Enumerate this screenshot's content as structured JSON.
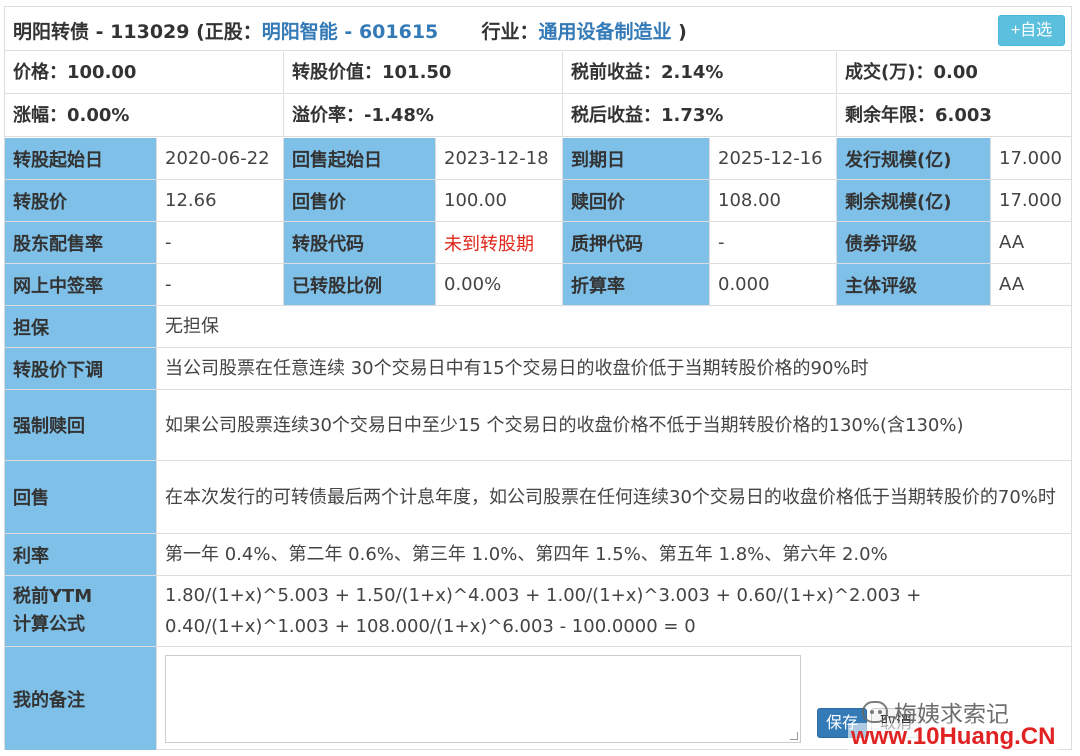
{
  "header": {
    "bond_name": "明阳转债",
    "bond_code": "113029",
    "stock_prefix": "(正股：",
    "stock_name": "明阳智能",
    "stock_code": "601615",
    "industry_label": "行业：",
    "industry": "通用设备制造业",
    "suffix": ")",
    "add_watch": "+自选"
  },
  "summary": [
    [
      "价格：100.00",
      "转股价值：101.50",
      "税前收益：2.14%",
      "成交(万)：0.00"
    ],
    [
      "涨幅：0.00%",
      "溢价率：-1.48%",
      "税后收益：1.73%",
      "剩余年限：6.003"
    ]
  ],
  "grid": [
    [
      {
        "label": "转股起始日",
        "value": "2020-06-22"
      },
      {
        "label": "回售起始日",
        "value": "2023-12-18"
      },
      {
        "label": "到期日",
        "value": "2025-12-16"
      },
      {
        "label": "发行规模(亿)",
        "value": "17.000"
      }
    ],
    [
      {
        "label": "转股价",
        "value": "12.66"
      },
      {
        "label": "回售价",
        "value": "100.00"
      },
      {
        "label": "赎回价",
        "value": "108.00"
      },
      {
        "label": "剩余规模(亿)",
        "value": "17.000"
      }
    ],
    [
      {
        "label": "股东配售率",
        "value": "-"
      },
      {
        "label": "转股代码",
        "value": "未到转股期"
      },
      {
        "label": "质押代码",
        "value": "-"
      },
      {
        "label": "债券评级",
        "value": "AA"
      }
    ],
    [
      {
        "label": "网上中签率",
        "value": "-"
      },
      {
        "label": "已转股比例",
        "value": "0.00%"
      },
      {
        "label": "折算率",
        "value": "0.000"
      },
      {
        "label": "主体评级",
        "value": "AA"
      }
    ]
  ],
  "terms": {
    "guarantee_label": "担保",
    "guarantee": "无担保",
    "downward_label": "转股价下调",
    "downward": "当公司股票在任意连续 30个交易日中有15个交易日的收盘价低于当期转股价格的90%时",
    "call_label": "强制赎回",
    "call": "如果公司股票连续30个交易日中至少15 个交易日的收盘价格不低于当期转股价格的130%(含130%)",
    "put_label": "回售",
    "put": "在本次发行的可转债最后两个计息年度，如公司股票在任何连续30个交易日的收盘价格低于当期转股价的70%时",
    "rate_label": "利率",
    "rate": "第一年 0.4%、第二年 0.6%、第三年 1.0%、第四年 1.5%、第五年 1.8%、第六年 2.0%",
    "ytm_label_1": "税前YTM",
    "ytm_label_2": "计算公式",
    "ytm_line_1": "1.80/(1+x)^5.003 + 1.50/(1+x)^4.003 + 1.00/(1+x)^3.003 + 0.60/(1+x)^2.003 +",
    "ytm_line_2": "0.40/(1+x)^1.003 + 108.000/(1+x)^6.003 - 100.0000 = 0"
  },
  "notes": {
    "label": "我的备注",
    "value": "",
    "save": "保存",
    "cancel": "取消"
  },
  "watermark": {
    "line1": "梅姨求索记",
    "line2": "www.10Huang.CN"
  },
  "colors": {
    "label_bg": "#7fc0e8",
    "link": "#337ab7",
    "alert": "#e0261a",
    "button_info": "#5bc0de",
    "button_primary": "#337ab7"
  }
}
